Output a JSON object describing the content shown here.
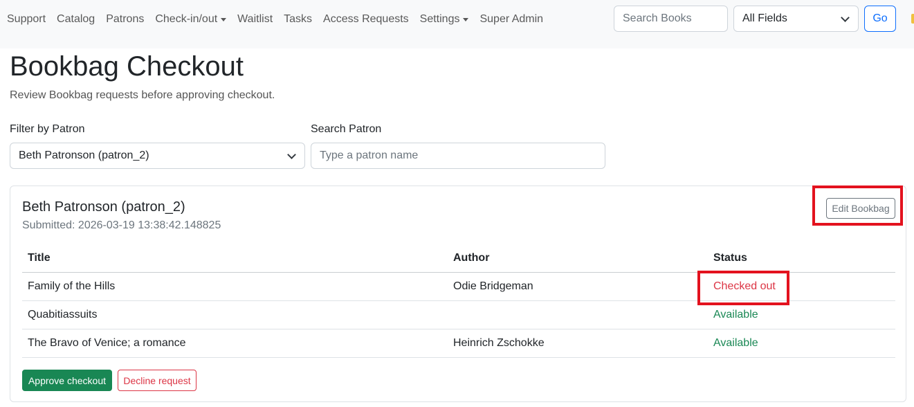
{
  "nav": {
    "items": [
      {
        "label": "Support",
        "dropdown": false
      },
      {
        "label": "Catalog",
        "dropdown": false
      },
      {
        "label": "Patrons",
        "dropdown": false
      },
      {
        "label": "Check-in/out",
        "dropdown": true
      },
      {
        "label": "Waitlist",
        "dropdown": false
      },
      {
        "label": "Tasks",
        "dropdown": false
      },
      {
        "label": "Access Requests",
        "dropdown": false
      },
      {
        "label": "Settings",
        "dropdown": true
      },
      {
        "label": "Super Admin",
        "dropdown": false
      }
    ],
    "search_placeholder": "Search Books",
    "field_select": "All Fields",
    "go_label": "Go"
  },
  "page": {
    "title": "Bookbag Checkout",
    "subtitle": "Review Bookbag requests before approving checkout."
  },
  "filters": {
    "patron_filter_label": "Filter by Patron",
    "patron_filter_value": "Beth Patronson (patron_2)",
    "search_label": "Search Patron",
    "search_placeholder": "Type a patron name"
  },
  "bookbag": {
    "patron": "Beth Patronson (patron_2)",
    "submitted": "Submitted: 2026-03-19 13:38:42.148825",
    "edit_label": "Edit Bookbag",
    "columns": [
      "Title",
      "Author",
      "Status"
    ],
    "rows": [
      {
        "title": "Family of the Hills",
        "author": "Odie Bridgeman",
        "status": "Checked out",
        "status_kind": "out"
      },
      {
        "title": "Quabitiassuits",
        "author": "",
        "status": "Available",
        "status_kind": "avail"
      },
      {
        "title": "The Bravo of Venice; a romance",
        "author": "Heinrich Zschokke",
        "status": "Available",
        "status_kind": "avail"
      }
    ],
    "approve_label": "Approve checkout",
    "decline_label": "Decline request"
  },
  "colors": {
    "primary": "#0d6efd",
    "success": "#198754",
    "danger": "#dc3545",
    "highlight": "#e3121e"
  }
}
